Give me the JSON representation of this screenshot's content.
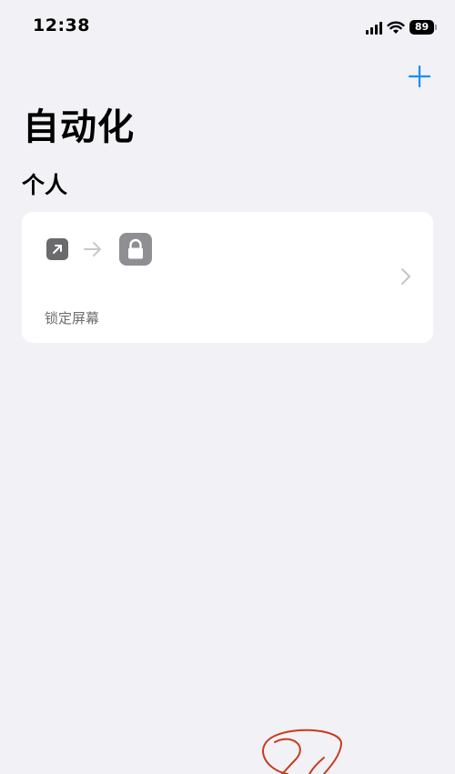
{
  "status_bar": {
    "time": "12:38",
    "battery": "89",
    "icons": [
      "signal-icon",
      "wifi-icon",
      "battery-icon"
    ]
  },
  "nav": {
    "add_icon": "plus-icon",
    "accent_color": "#1a8cff"
  },
  "page_title": "自动化",
  "section_title": "个人",
  "automations": [
    {
      "trigger_icon": "open-app-icon",
      "separator_icon": "arrow-right-icon",
      "action_icon": "lock-icon",
      "label": "锁定屏幕"
    }
  ],
  "colors": {
    "background": "#f2f1f6",
    "card": "#ffffff",
    "annotation": "#c83a1e"
  }
}
